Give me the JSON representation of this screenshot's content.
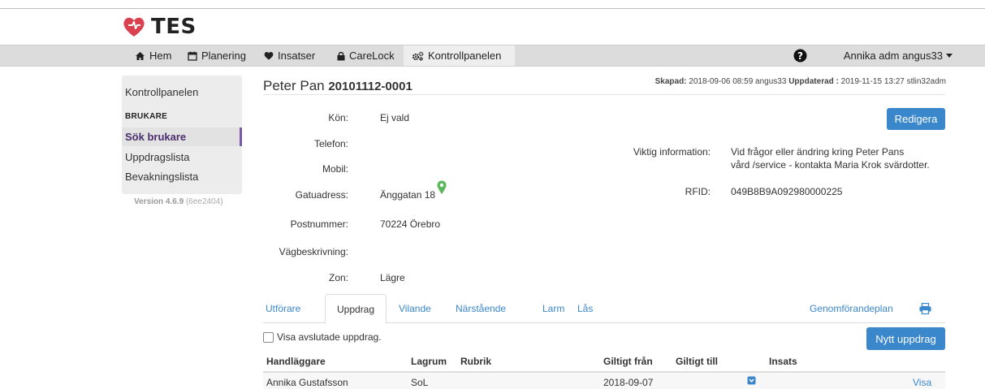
{
  "app": {
    "logo_text": "TES",
    "brand_color": "#d9414f"
  },
  "nav": {
    "items": [
      {
        "label": "Hem",
        "icon": "home-icon"
      },
      {
        "label": "Planering",
        "icon": "calendar-icon"
      },
      {
        "label": "Insatser",
        "icon": "heart-icon"
      },
      {
        "label": "CareLock",
        "icon": "lock-icon"
      },
      {
        "label": "Kontrollpanelen",
        "icon": "gears-icon"
      }
    ],
    "active": "Kontrollpanelen",
    "help_icon": "question-circle-icon",
    "user": "Annika adm angus33"
  },
  "sidebar": {
    "title": "Kontrollpanelen",
    "section": "BRUKARE",
    "items": [
      {
        "label": "Sök brukare",
        "active": true
      },
      {
        "label": "Uppdragslista",
        "active": false
      },
      {
        "label": "Bevakningslista",
        "active": false
      }
    ],
    "version_label": "Version 4.6.9",
    "version_hash": "(6ee2404)",
    "active_color": "#7b5aa6"
  },
  "person": {
    "name": "Peter Pan",
    "id": "20101112-0001",
    "created_label": "Skapad:",
    "created_value": "2018-09-06 08:59 angus33",
    "updated_label": "Uppdaterad :",
    "updated_value": "2019-11-15 13:27 stlin32adm",
    "edit_button": "Redigera"
  },
  "details": {
    "kon_label": "Kön:",
    "kon_value": "Ej vald",
    "telefon_label": "Telefon:",
    "telefon_value": "",
    "mobil_label": "Mobil:",
    "mobil_value": "",
    "gatuadress_label": "Gatuadress:",
    "gatuadress_value": "Änggatan 18",
    "map_icon": "map-marker-icon",
    "postnummer_label": "Postnummer:",
    "postnummer_value": "70224 Örebro",
    "vagbeskrivning_label": "Vägbeskrivning:",
    "vagbeskrivning_value": "",
    "zon_label": "Zon:",
    "zon_value": "Lägre",
    "viktig_label": "Viktig information:",
    "viktig_line1": "Vid frågor eller ändring kring Peter Pans",
    "viktig_line2": "vård /service - kontakta Maria Krok svärdotter.",
    "rfid_label": "RFID:",
    "rfid_value": "049B8B9A092980000225"
  },
  "tabs": {
    "items": [
      "Utförare",
      "Uppdrag",
      "Vilande",
      "Närstående",
      "Larm",
      "Lås"
    ],
    "active": "Uppdrag",
    "plan_link": "Genomförandeplan",
    "print_icon": "print-icon"
  },
  "assignments": {
    "show_finished_label": "Visa avslutade uppdrag.",
    "show_finished_checked": false,
    "new_button": "Nytt uppdrag",
    "columns": [
      "Handläggare",
      "Lagrum",
      "Rubrik",
      "Giltigt från",
      "Giltigt till",
      "Insats"
    ],
    "rows": [
      {
        "handlaggare": "Annika Gustafsson",
        "lagrum": "SoL",
        "rubrik": "",
        "giltigt_fran": "2018-09-07",
        "giltigt_till": "",
        "insats_icon": "expand-icon",
        "action": "Visa"
      }
    ]
  }
}
